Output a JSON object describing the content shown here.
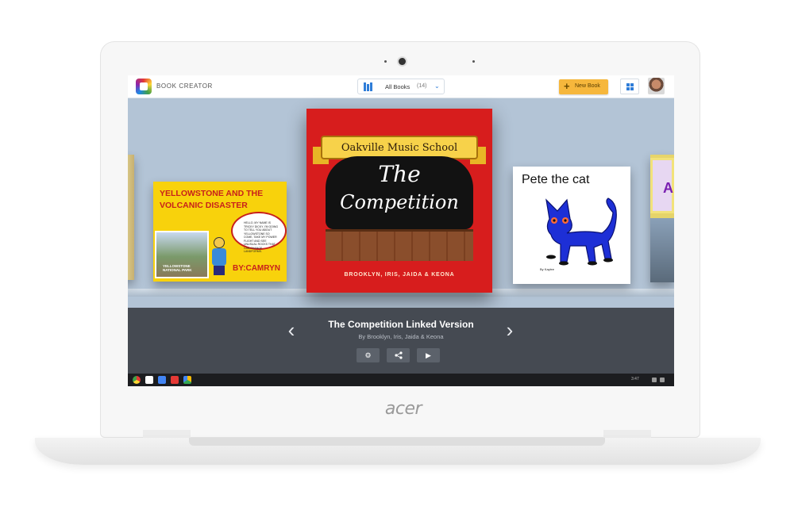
{
  "app": {
    "title": "BOOK CREATOR",
    "library_label": "All Books",
    "library_count": "(14)",
    "new_book_label": "New Book"
  },
  "books": {
    "left_edge_letter": "A",
    "yellowstone": {
      "title": "Yellowstone and the Volcanic Disaster",
      "photo_caption": "YELLOWSTONE NATIONAL PARK",
      "speech": "HELLO, MY NAME IS TRICKY DICKY. I'M GOING TO TELL YOU ABOUT YELLOWSTONE SO COME, TAKE MY POWER FLIGHT AND SEE UNUSUAL ROCKS THAT CAN CHANGE LANDFORMS.",
      "author": "BY:CAMRYN"
    },
    "competition": {
      "school": "Oakville Music School",
      "title_line_1": "The",
      "title_line_2": "Competition",
      "authors": "Brooklyn, Iris, Jaida & Keona"
    },
    "pete": {
      "title": "Pete the cat",
      "byline": "By Kaylee"
    }
  },
  "selected": {
    "title": "The Competition Linked Version",
    "author": "By Brooklyn, Iris, Jaida & Keona"
  },
  "icons": {
    "prev": "chevron-left-icon",
    "next": "chevron-right-icon",
    "settings": "gear-icon",
    "share": "share-icon",
    "play": "play-icon"
  },
  "taskbar": {
    "time": "3:47"
  },
  "laptop": {
    "brand": "acer"
  },
  "colors": {
    "accent": "#2f7dd8",
    "new_book": "#f6b73c",
    "info_panel": "#454a52"
  }
}
